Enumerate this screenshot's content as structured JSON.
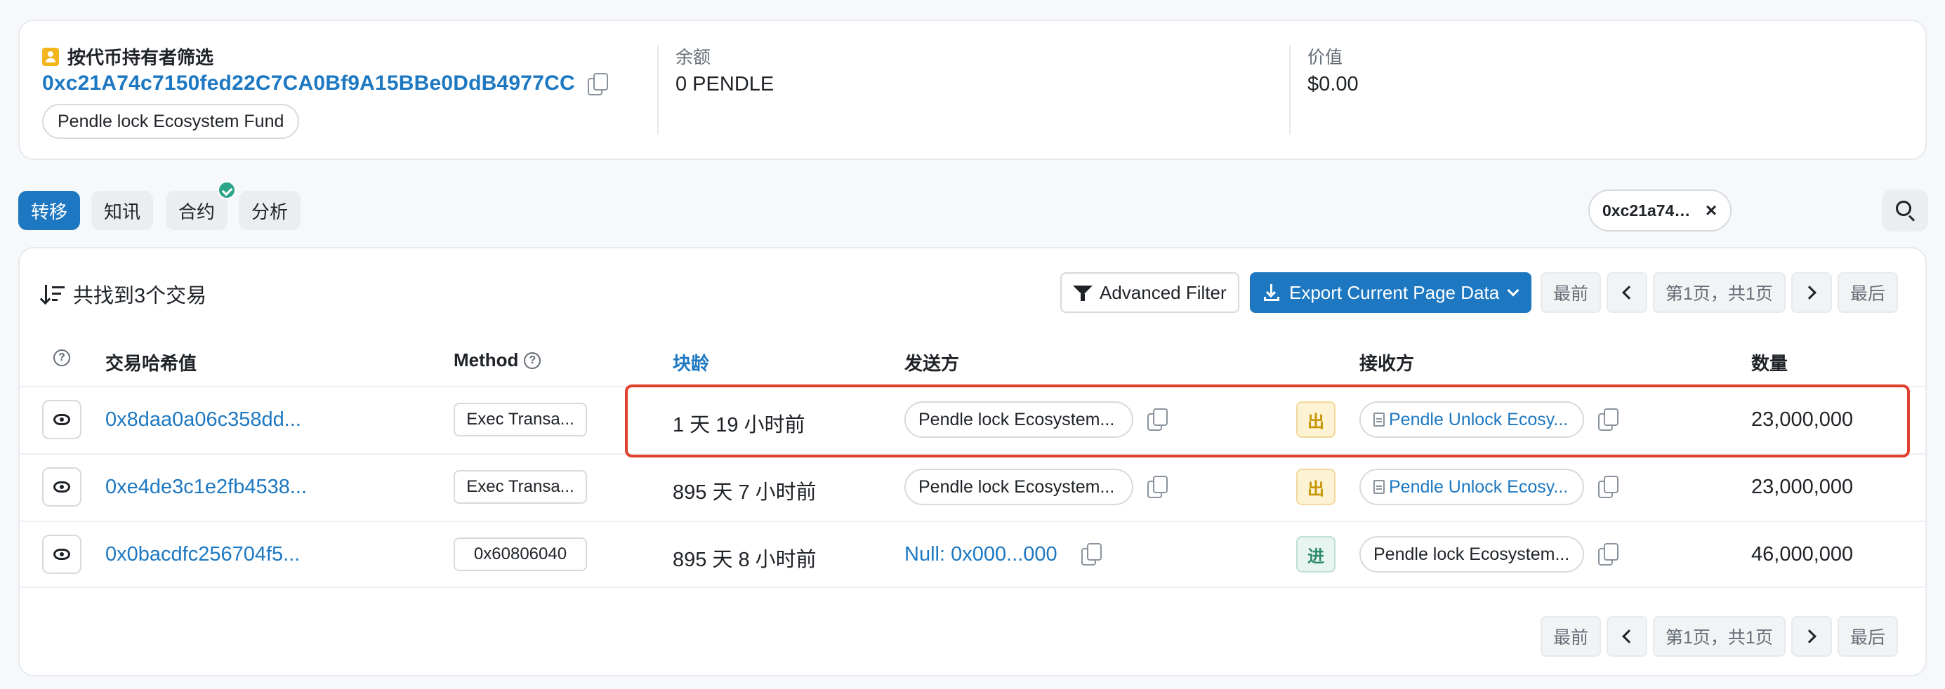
{
  "summary": {
    "filter_label": "按代币持有者筛选",
    "address": "0xc21A74c7150fed22C7CA0Bf9A15BBe0DdB4977CC",
    "tag": "Pendle lock Ecosystem Fund",
    "balance_label": "余额",
    "balance_value": "0 PENDLE",
    "value_label": "价值",
    "value_value": "$0.00"
  },
  "tabs": [
    {
      "label": "转移",
      "active": true
    },
    {
      "label": "知讯",
      "active": false
    },
    {
      "label": "合约",
      "active": false,
      "verified": true
    },
    {
      "label": "分析",
      "active": false
    }
  ],
  "search": {
    "chip_text": "0xc21a74c7150fed22c7ca0...",
    "close_glyph": "×"
  },
  "table": {
    "found_text": "共找到3个交易",
    "advanced_filter": "Advanced Filter",
    "export_label": "Export Current Page Data",
    "pager": {
      "first": "最前",
      "page_info": "第1页，共1页",
      "last": "最后"
    },
    "columns": {
      "hash": "交易哈希值",
      "method": "Method",
      "age": "块龄",
      "from": "发送方",
      "to": "接收方",
      "amount": "数量"
    },
    "rows": [
      {
        "hash": "0x8daa0a06c358dd...",
        "method": "Exec Transa...",
        "age": "1 天 19 小时前",
        "from": "Pendle lock Ecosystem...",
        "direction": "出",
        "to": "Pendle Unlock Ecosy...",
        "amount": "23,000,000",
        "highlighted": true
      },
      {
        "hash": "0xe4de3c1e2fb4538...",
        "method": "Exec Transa...",
        "age": "895 天 7 小时前",
        "from": "Pendle lock Ecosystem...",
        "direction": "出",
        "to": "Pendle Unlock Ecosy...",
        "amount": "23,000,000",
        "highlighted": false
      },
      {
        "hash": "0x0bacdfc256704f5...",
        "method": "0x60806040",
        "age": "895 天 8 小时前",
        "from": "Null: 0x000...000",
        "direction": "进",
        "to": "Pendle lock Ecosystem...",
        "amount": "46,000,000",
        "highlighted": false
      }
    ]
  },
  "colors": {
    "accent": "#1d78c1",
    "highlight_border": "#e0402e",
    "out_badge": "#fdf2d3",
    "in_badge": "#e8f4ef",
    "verified": "#2ea58a"
  }
}
